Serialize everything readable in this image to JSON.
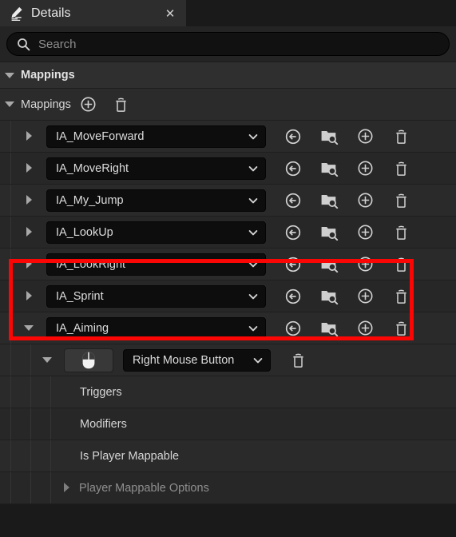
{
  "window": {
    "tab_title": "Details",
    "tab_icon": "details-pencil-icon",
    "close_label": "✕"
  },
  "search": {
    "placeholder": "Search",
    "value": "",
    "icon": "search-icon"
  },
  "sections": {
    "category_label": "Mappings",
    "array_label": "Mappings",
    "add_icon": "plus-circle-icon",
    "delete_icon": "trash-icon"
  },
  "row_icons": {
    "browse": "browse-to-asset-icon",
    "find": "folder-search-icon",
    "add": "plus-circle-icon",
    "remove": "trash-icon",
    "chevron": "chevron-down-icon"
  },
  "mappings": [
    {
      "name": "IA_MoveForward",
      "expanded": false
    },
    {
      "name": "IA_MoveRight",
      "expanded": false
    },
    {
      "name": "IA_My_Jump",
      "expanded": false
    },
    {
      "name": "IA_LookUp",
      "expanded": false
    },
    {
      "name": "IA_LookRight",
      "expanded": false
    },
    {
      "name": "IA_Sprint",
      "expanded": false
    },
    {
      "name": "IA_Aiming",
      "expanded": true
    }
  ],
  "key_binding": {
    "device_icon": "mouse-icon",
    "key_value": "Right Mouse Button",
    "delete_icon": "trash-icon"
  },
  "properties": [
    {
      "label": "Triggers",
      "dim": false,
      "expandable": false
    },
    {
      "label": "Modifiers",
      "dim": false,
      "expandable": false
    },
    {
      "label": "Is Player Mappable",
      "dim": false,
      "expandable": false
    },
    {
      "label": "Player Mappable Options",
      "dim": true,
      "expandable": true
    }
  ],
  "annotation": {
    "color": "#fc0505",
    "target": "IA_Aiming mapping and its Right Mouse Button key binding"
  }
}
